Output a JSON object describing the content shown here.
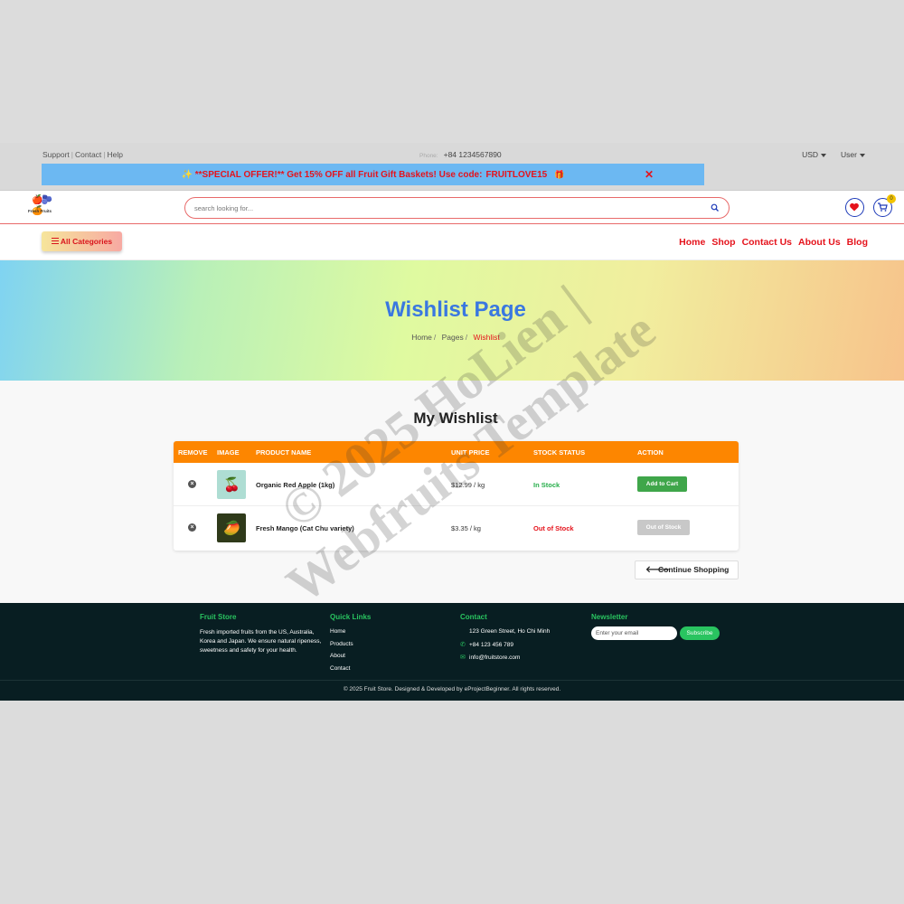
{
  "topbar": {
    "links": [
      "Support",
      "Contact",
      "Help"
    ],
    "phone_label": "Phone:",
    "phone": "+84 1234567890",
    "currency": "USD",
    "user": "User"
  },
  "promo": {
    "prefix": "✨ **SPECIAL OFFER!** Get 15% OFF all Fruit Gift Baskets! Use code:",
    "code": "FRUITLOVE15",
    "gift": "🎁",
    "close": "✕"
  },
  "header": {
    "logo_text": "Fresh Fruits",
    "logo_fruits": "🍎🫐🍊",
    "search_placeholder": "search looking for...",
    "cart_count": "0"
  },
  "nav": {
    "all_categories": "All Categories",
    "menu": [
      "Home",
      "Shop",
      "Contact Us",
      "About Us",
      "Blog"
    ]
  },
  "hero": {
    "title": "Wishlist Page",
    "breadcrumbs": [
      "Home",
      "Pages",
      "Wishlist"
    ],
    "sep": "/"
  },
  "wishlist": {
    "title": "My Wishlist",
    "headers": [
      "REMOVE",
      "IMAGE",
      "PRODUCT NAME",
      "UNIT PRICE",
      "STOCK STATUS",
      "ACTION"
    ],
    "rows": [
      {
        "name": "Organic Red Apple (1kg)",
        "price": "$12.99 / kg",
        "stock": "In Stock",
        "action": "Add to Cart",
        "image": "🍒"
      },
      {
        "name": "Fresh Mango (Cat Chu variety)",
        "price": "$3.35 / kg",
        "stock": "Out of Stock",
        "action": "Out of Stock",
        "image": "🥭"
      }
    ],
    "continue": "Continue Shopping"
  },
  "footer": {
    "store_title": "Fruit Store",
    "store_text": "Fresh imported fruits from the US, Australia, Korea and Japan. We ensure natural ripeness, sweetness and safety for your health.",
    "links_title": "Quick Links",
    "links": [
      "Home",
      "Products",
      "About",
      "Contact"
    ],
    "contact_title": "Contact",
    "address": "123 Green Street, Ho Chi Minh",
    "phone": "+84 123 456 789",
    "email": "info@fruitstore.com",
    "newsletter_title": "Newsletter",
    "email_placeholder": "Enter your email",
    "subscribe": "Subscribe",
    "copyright": "© 2025 Fruit Store. Designed & Developed by eProjectBeginner. All rights reserved."
  },
  "watermark": {
    "line1": "© 2025 HoLien |",
    "line2": "Webfruits Template"
  },
  "colors": {
    "accent_red": "#e5131c",
    "table_header": "#fd8600",
    "in_stock": "#27ae4b",
    "footer_bg": "#081e22",
    "title_blue": "#3a78e0"
  }
}
